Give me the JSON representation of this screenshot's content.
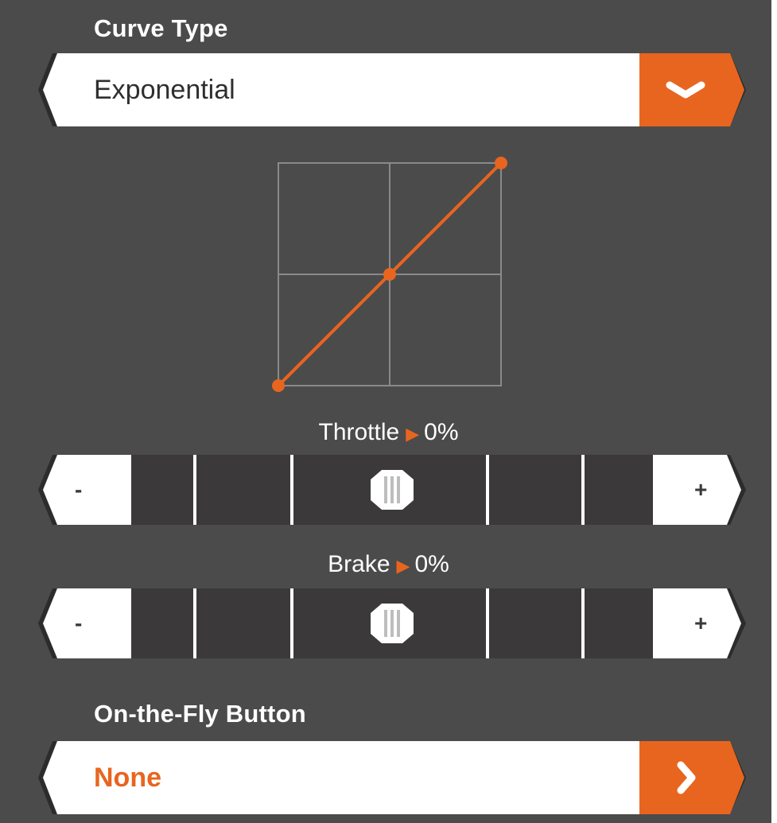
{
  "curve_type": {
    "title": "Curve Type",
    "selected": "Exponential",
    "dropdown_icon": "chevron-down-icon"
  },
  "chart_data": {
    "type": "line",
    "title": "",
    "xlabel": "",
    "ylabel": "",
    "xlim": [
      -100,
      100
    ],
    "ylim": [
      -100,
      100
    ],
    "grid": true,
    "series": [
      {
        "x": [
          -100,
          0,
          100
        ],
        "y": [
          -100,
          0,
          100
        ]
      }
    ],
    "line_color": "#e8651f"
  },
  "throttle": {
    "label": "Throttle",
    "arrow": "▶",
    "value_text": "0%",
    "value": 0,
    "minus_label": "-",
    "plus_label": "+"
  },
  "brake": {
    "label": "Brake",
    "arrow": "▶",
    "value_text": "0%",
    "value": 0,
    "minus_label": "-",
    "plus_label": "+"
  },
  "on_the_fly": {
    "title": "On-the-Fly Button",
    "selected": "None",
    "next_icon": "chevron-right-icon"
  },
  "colors": {
    "background": "#4b4b4b",
    "accent": "#e8651f",
    "track": "#3b393a",
    "field": "#ffffff"
  }
}
